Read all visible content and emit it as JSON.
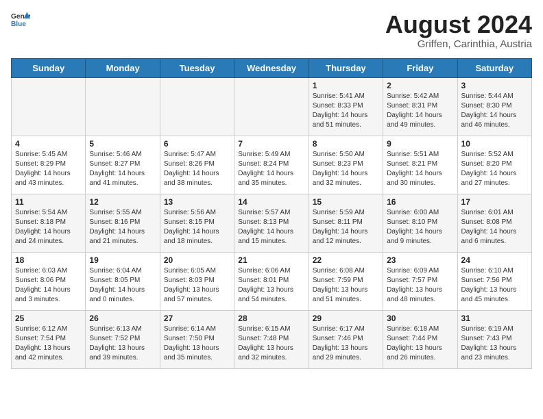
{
  "header": {
    "logo_general": "General",
    "logo_blue": "Blue",
    "title": "August 2024",
    "location": "Griffen, Carinthia, Austria"
  },
  "days_of_week": [
    "Sunday",
    "Monday",
    "Tuesday",
    "Wednesday",
    "Thursday",
    "Friday",
    "Saturday"
  ],
  "weeks": [
    [
      {
        "day": "",
        "info": ""
      },
      {
        "day": "",
        "info": ""
      },
      {
        "day": "",
        "info": ""
      },
      {
        "day": "",
        "info": ""
      },
      {
        "day": "1",
        "info": "Sunrise: 5:41 AM\nSunset: 8:33 PM\nDaylight: 14 hours and 51 minutes."
      },
      {
        "day": "2",
        "info": "Sunrise: 5:42 AM\nSunset: 8:31 PM\nDaylight: 14 hours and 49 minutes."
      },
      {
        "day": "3",
        "info": "Sunrise: 5:44 AM\nSunset: 8:30 PM\nDaylight: 14 hours and 46 minutes."
      }
    ],
    [
      {
        "day": "4",
        "info": "Sunrise: 5:45 AM\nSunset: 8:29 PM\nDaylight: 14 hours and 43 minutes."
      },
      {
        "day": "5",
        "info": "Sunrise: 5:46 AM\nSunset: 8:27 PM\nDaylight: 14 hours and 41 minutes."
      },
      {
        "day": "6",
        "info": "Sunrise: 5:47 AM\nSunset: 8:26 PM\nDaylight: 14 hours and 38 minutes."
      },
      {
        "day": "7",
        "info": "Sunrise: 5:49 AM\nSunset: 8:24 PM\nDaylight: 14 hours and 35 minutes."
      },
      {
        "day": "8",
        "info": "Sunrise: 5:50 AM\nSunset: 8:23 PM\nDaylight: 14 hours and 32 minutes."
      },
      {
        "day": "9",
        "info": "Sunrise: 5:51 AM\nSunset: 8:21 PM\nDaylight: 14 hours and 30 minutes."
      },
      {
        "day": "10",
        "info": "Sunrise: 5:52 AM\nSunset: 8:20 PM\nDaylight: 14 hours and 27 minutes."
      }
    ],
    [
      {
        "day": "11",
        "info": "Sunrise: 5:54 AM\nSunset: 8:18 PM\nDaylight: 14 hours and 24 minutes."
      },
      {
        "day": "12",
        "info": "Sunrise: 5:55 AM\nSunset: 8:16 PM\nDaylight: 14 hours and 21 minutes."
      },
      {
        "day": "13",
        "info": "Sunrise: 5:56 AM\nSunset: 8:15 PM\nDaylight: 14 hours and 18 minutes."
      },
      {
        "day": "14",
        "info": "Sunrise: 5:57 AM\nSunset: 8:13 PM\nDaylight: 14 hours and 15 minutes."
      },
      {
        "day": "15",
        "info": "Sunrise: 5:59 AM\nSunset: 8:11 PM\nDaylight: 14 hours and 12 minutes."
      },
      {
        "day": "16",
        "info": "Sunrise: 6:00 AM\nSunset: 8:10 PM\nDaylight: 14 hours and 9 minutes."
      },
      {
        "day": "17",
        "info": "Sunrise: 6:01 AM\nSunset: 8:08 PM\nDaylight: 14 hours and 6 minutes."
      }
    ],
    [
      {
        "day": "18",
        "info": "Sunrise: 6:03 AM\nSunset: 8:06 PM\nDaylight: 14 hours and 3 minutes."
      },
      {
        "day": "19",
        "info": "Sunrise: 6:04 AM\nSunset: 8:05 PM\nDaylight: 14 hours and 0 minutes."
      },
      {
        "day": "20",
        "info": "Sunrise: 6:05 AM\nSunset: 8:03 PM\nDaylight: 13 hours and 57 minutes."
      },
      {
        "day": "21",
        "info": "Sunrise: 6:06 AM\nSunset: 8:01 PM\nDaylight: 13 hours and 54 minutes."
      },
      {
        "day": "22",
        "info": "Sunrise: 6:08 AM\nSunset: 7:59 PM\nDaylight: 13 hours and 51 minutes."
      },
      {
        "day": "23",
        "info": "Sunrise: 6:09 AM\nSunset: 7:57 PM\nDaylight: 13 hours and 48 minutes."
      },
      {
        "day": "24",
        "info": "Sunrise: 6:10 AM\nSunset: 7:56 PM\nDaylight: 13 hours and 45 minutes."
      }
    ],
    [
      {
        "day": "25",
        "info": "Sunrise: 6:12 AM\nSunset: 7:54 PM\nDaylight: 13 hours and 42 minutes."
      },
      {
        "day": "26",
        "info": "Sunrise: 6:13 AM\nSunset: 7:52 PM\nDaylight: 13 hours and 39 minutes."
      },
      {
        "day": "27",
        "info": "Sunrise: 6:14 AM\nSunset: 7:50 PM\nDaylight: 13 hours and 35 minutes."
      },
      {
        "day": "28",
        "info": "Sunrise: 6:15 AM\nSunset: 7:48 PM\nDaylight: 13 hours and 32 minutes."
      },
      {
        "day": "29",
        "info": "Sunrise: 6:17 AM\nSunset: 7:46 PM\nDaylight: 13 hours and 29 minutes."
      },
      {
        "day": "30",
        "info": "Sunrise: 6:18 AM\nSunset: 7:44 PM\nDaylight: 13 hours and 26 minutes."
      },
      {
        "day": "31",
        "info": "Sunrise: 6:19 AM\nSunset: 7:43 PM\nDaylight: 13 hours and 23 minutes."
      }
    ]
  ]
}
